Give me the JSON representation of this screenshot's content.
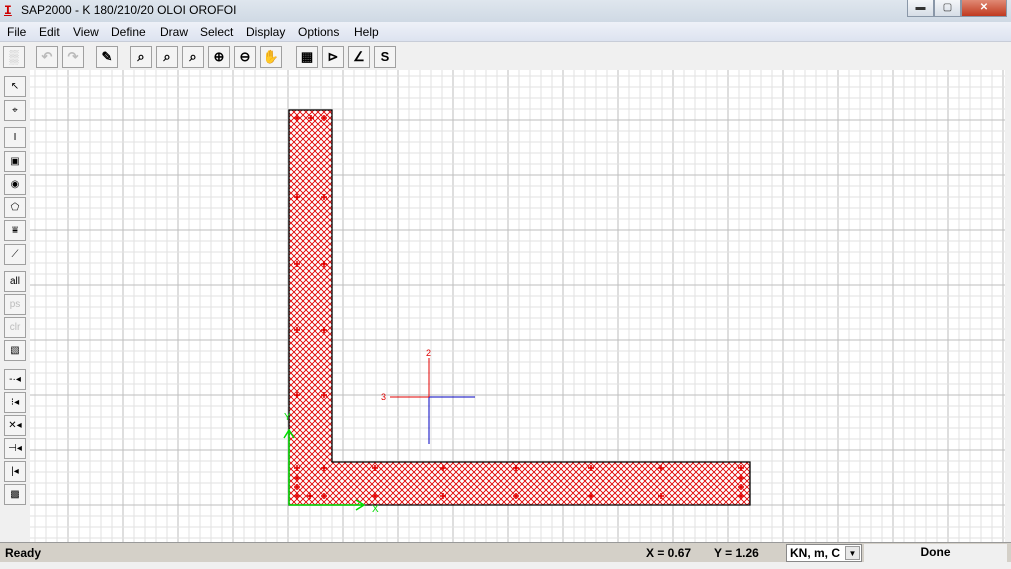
{
  "window": {
    "title": "SAP2000 - K 180/210/20 OLOI OROFOI",
    "app_icon": "I",
    "controls": [
      "minimize",
      "maximize",
      "close"
    ]
  },
  "menu": [
    "File",
    "Edit",
    "View",
    "Define",
    "Draw",
    "Select",
    "Display",
    "Options",
    "Help"
  ],
  "toolbar": [
    {
      "name": "new-icon",
      "glyph": "▒",
      "disabled": true
    },
    {
      "name": "undo-icon",
      "glyph": "↶",
      "disabled": true
    },
    {
      "name": "redo-icon",
      "glyph": "↷",
      "disabled": true
    },
    {
      "name": "pencil-icon",
      "glyph": "✎"
    },
    {
      "name": "zoom-window-icon",
      "glyph": "⌕"
    },
    {
      "name": "zoom-restore-icon",
      "glyph": "⌕"
    },
    {
      "name": "zoom-previous-icon",
      "glyph": "⌕"
    },
    {
      "name": "zoom-in-icon",
      "glyph": "⊕"
    },
    {
      "name": "zoom-out-icon",
      "glyph": "⊖"
    },
    {
      "name": "pan-icon",
      "glyph": "✋"
    },
    {
      "name": "table-icon",
      "glyph": "▦"
    },
    {
      "name": "section-properties-icon",
      "glyph": "⊳"
    },
    {
      "name": "angle-icon",
      "glyph": "∠"
    },
    {
      "name": "stress-icon",
      "glyph": "S"
    }
  ],
  "left_toolbar": [
    {
      "name": "pointer-icon",
      "glyph": "↖"
    },
    {
      "name": "reshape-icon",
      "glyph": "⌖"
    },
    {
      "name": "draw-i-section-icon",
      "glyph": "I"
    },
    {
      "name": "draw-rectangle-icon",
      "glyph": "▣"
    },
    {
      "name": "draw-circle-icon",
      "glyph": "◉"
    },
    {
      "name": "draw-polygon-icon",
      "glyph": "⬠"
    },
    {
      "name": "draw-rebar-line-icon",
      "glyph": "⩸"
    },
    {
      "name": "draw-line-icon",
      "glyph": "⟋"
    },
    {
      "name": "select-all-icon",
      "glyph": "all"
    },
    {
      "name": "previous-selection-icon",
      "glyph": "ps",
      "disabled": true
    },
    {
      "name": "clear-selection-icon",
      "glyph": "clr",
      "disabled": true
    },
    {
      "name": "intersecting-line-icon",
      "glyph": "▧"
    },
    {
      "name": "snap-points-icon",
      "glyph": "-·◂"
    },
    {
      "name": "snap-ends-icon",
      "glyph": "⁝◂"
    },
    {
      "name": "snap-intersections-icon",
      "glyph": "✕◂"
    },
    {
      "name": "snap-perpendicular-icon",
      "glyph": "⊣◂"
    },
    {
      "name": "snap-lines-icon",
      "glyph": "|◂"
    },
    {
      "name": "snap-grid-icon",
      "glyph": "▩"
    }
  ],
  "canvas": {
    "axis_labels": {
      "x": "X",
      "y": "Y",
      "local2": "2",
      "local3": "3"
    },
    "section_color": "#e00000",
    "axis_color": "#00dd00"
  },
  "status": {
    "left": "Ready",
    "x": "X = 0.67",
    "y": "Y = 1.26",
    "units": "KN, m, C",
    "right": "Done"
  }
}
